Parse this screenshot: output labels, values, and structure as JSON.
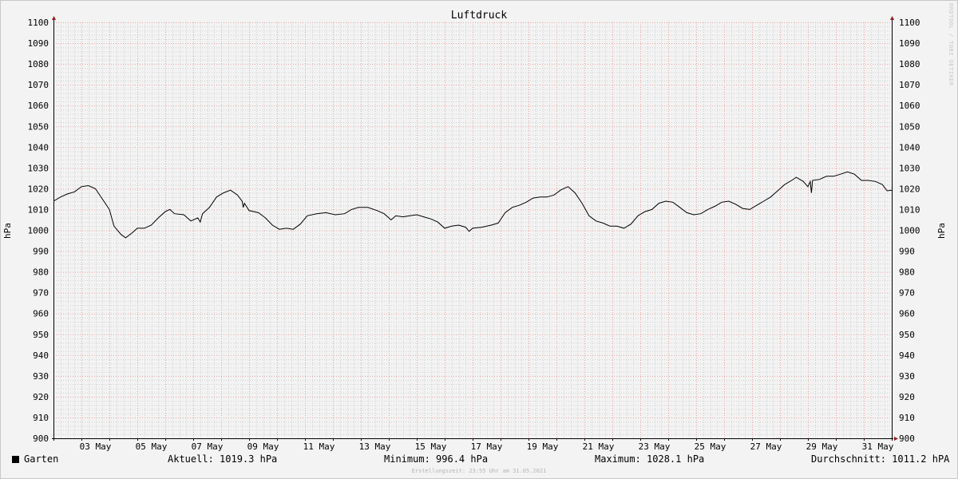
{
  "chart_data": {
    "type": "line",
    "title": "Luftdruck",
    "ylabel_left": "hPa",
    "ylabel_right": "hPa",
    "ylim": [
      900,
      1100
    ],
    "y_ticks": [
      900,
      910,
      920,
      930,
      940,
      950,
      960,
      970,
      980,
      990,
      1000,
      1010,
      1020,
      1030,
      1040,
      1050,
      1060,
      1070,
      1080,
      1090,
      1100
    ],
    "xlim": [
      "2021-05-02 00:00",
      "2021-06-01 00:00"
    ],
    "x_ticks": [
      "03 May",
      "05 May",
      "07 May",
      "09 May",
      "11 May",
      "13 May",
      "15 May",
      "17 May",
      "19 May",
      "21 May",
      "23 May",
      "25 May",
      "27 May",
      "29 May",
      "31 May"
    ],
    "grid": true,
    "series": [
      {
        "name": "Garten",
        "color": "#000000",
        "points": [
          [
            "2021-05-02 00:00",
            1014.0
          ],
          [
            "2021-05-02 06:00",
            1016.0
          ],
          [
            "2021-05-02 12:00",
            1017.5
          ],
          [
            "2021-05-02 18:00",
            1018.5
          ],
          [
            "2021-05-03 00:00",
            1021.0
          ],
          [
            "2021-05-03 06:00",
            1021.5
          ],
          [
            "2021-05-03 12:00",
            1020.0
          ],
          [
            "2021-05-03 18:00",
            1015.0
          ],
          [
            "2021-05-04 00:00",
            1010.0
          ],
          [
            "2021-05-04 04:00",
            1002.0
          ],
          [
            "2021-05-04 10:00",
            998.0
          ],
          [
            "2021-05-04 14:00",
            996.4
          ],
          [
            "2021-05-04 20:00",
            999.0
          ],
          [
            "2021-05-05 00:00",
            1001.0
          ],
          [
            "2021-05-05 06:00",
            1001.0
          ],
          [
            "2021-05-05 12:00",
            1002.5
          ],
          [
            "2021-05-05 18:00",
            1006.0
          ],
          [
            "2021-05-06 00:00",
            1009.0
          ],
          [
            "2021-05-06 04:00",
            1010.0
          ],
          [
            "2021-05-06 08:00",
            1008.0
          ],
          [
            "2021-05-06 16:00",
            1007.5
          ],
          [
            "2021-05-06 22:00",
            1004.5
          ],
          [
            "2021-05-07 04:00",
            1006.0
          ],
          [
            "2021-05-07 06:00",
            1004.0
          ],
          [
            "2021-05-07 08:00",
            1008.0
          ],
          [
            "2021-05-07 14:00",
            1011.0
          ],
          [
            "2021-05-07 20:00",
            1016.0
          ],
          [
            "2021-05-08 02:00",
            1018.0
          ],
          [
            "2021-05-08 08:00",
            1019.3
          ],
          [
            "2021-05-08 14:00",
            1017.0
          ],
          [
            "2021-05-08 18:00",
            1014.0
          ],
          [
            "2021-05-08 19:00",
            1011.0
          ],
          [
            "2021-05-08 20:00",
            1013.0
          ],
          [
            "2021-05-09 00:00",
            1009.5
          ],
          [
            "2021-05-09 08:00",
            1008.5
          ],
          [
            "2021-05-09 14:00",
            1006.0
          ],
          [
            "2021-05-09 20:00",
            1002.5
          ],
          [
            "2021-05-10 02:00",
            1000.5
          ],
          [
            "2021-05-10 08:00",
            1001.0
          ],
          [
            "2021-05-10 14:00",
            1000.5
          ],
          [
            "2021-05-10 20:00",
            1003.0
          ],
          [
            "2021-05-11 02:00",
            1007.0
          ],
          [
            "2021-05-11 10:00",
            1008.0
          ],
          [
            "2021-05-11 18:00",
            1008.5
          ],
          [
            "2021-05-12 02:00",
            1007.5
          ],
          [
            "2021-05-12 10:00",
            1008.0
          ],
          [
            "2021-05-12 16:00",
            1010.0
          ],
          [
            "2021-05-12 22:00",
            1011.0
          ],
          [
            "2021-05-13 06:00",
            1011.0
          ],
          [
            "2021-05-13 14:00",
            1009.5
          ],
          [
            "2021-05-13 20:00",
            1008.0
          ],
          [
            "2021-05-14 02:00",
            1005.0
          ],
          [
            "2021-05-14 06:00",
            1007.0
          ],
          [
            "2021-05-14 12:00",
            1006.5
          ],
          [
            "2021-05-14 18:00",
            1007.0
          ],
          [
            "2021-05-15 00:00",
            1007.5
          ],
          [
            "2021-05-15 06:00",
            1006.5
          ],
          [
            "2021-05-15 12:00",
            1005.5
          ],
          [
            "2021-05-15 18:00",
            1004.0
          ],
          [
            "2021-05-16 00:00",
            1001.0
          ],
          [
            "2021-05-16 06:00",
            1002.0
          ],
          [
            "2021-05-16 12:00",
            1002.5
          ],
          [
            "2021-05-16 18:00",
            1001.5
          ],
          [
            "2021-05-16 21:00",
            999.5
          ],
          [
            "2021-05-17 00:00",
            1001.0
          ],
          [
            "2021-05-17 08:00",
            1001.5
          ],
          [
            "2021-05-17 16:00",
            1002.5
          ],
          [
            "2021-05-17 22:00",
            1003.5
          ],
          [
            "2021-05-18 04:00",
            1008.5
          ],
          [
            "2021-05-18 10:00",
            1011.0
          ],
          [
            "2021-05-18 16:00",
            1012.0
          ],
          [
            "2021-05-18 22:00",
            1013.5
          ],
          [
            "2021-05-19 04:00",
            1015.5
          ],
          [
            "2021-05-19 10:00",
            1016.0
          ],
          [
            "2021-05-19 16:00",
            1016.0
          ],
          [
            "2021-05-19 22:00",
            1017.0
          ],
          [
            "2021-05-20 04:00",
            1019.5
          ],
          [
            "2021-05-20 10:00",
            1021.0
          ],
          [
            "2021-05-20 16:00",
            1018.0
          ],
          [
            "2021-05-20 22:00",
            1013.0
          ],
          [
            "2021-05-21 04:00",
            1007.0
          ],
          [
            "2021-05-21 10:00",
            1004.5
          ],
          [
            "2021-05-21 16:00",
            1003.5
          ],
          [
            "2021-05-21 22:00",
            1002.0
          ],
          [
            "2021-05-22 04:00",
            1002.0
          ],
          [
            "2021-05-22 10:00",
            1001.0
          ],
          [
            "2021-05-22 16:00",
            1003.0
          ],
          [
            "2021-05-22 22:00",
            1007.0
          ],
          [
            "2021-05-23 04:00",
            1009.0
          ],
          [
            "2021-05-23 10:00",
            1010.0
          ],
          [
            "2021-05-23 16:00",
            1013.0
          ],
          [
            "2021-05-23 22:00",
            1014.0
          ],
          [
            "2021-05-24 04:00",
            1013.5
          ],
          [
            "2021-05-24 10:00",
            1011.0
          ],
          [
            "2021-05-24 16:00",
            1008.5
          ],
          [
            "2021-05-24 22:00",
            1007.5
          ],
          [
            "2021-05-25 04:00",
            1008.0
          ],
          [
            "2021-05-25 10:00",
            1010.0
          ],
          [
            "2021-05-25 16:00",
            1011.5
          ],
          [
            "2021-05-25 22:00",
            1013.5
          ],
          [
            "2021-05-26 04:00",
            1014.0
          ],
          [
            "2021-05-26 10:00",
            1012.5
          ],
          [
            "2021-05-26 16:00",
            1010.5
          ],
          [
            "2021-05-26 22:00",
            1010.0
          ],
          [
            "2021-05-27 04:00",
            1012.0
          ],
          [
            "2021-05-27 10:00",
            1014.0
          ],
          [
            "2021-05-27 16:00",
            1016.0
          ],
          [
            "2021-05-27 22:00",
            1019.0
          ],
          [
            "2021-05-28 04:00",
            1022.0
          ],
          [
            "2021-05-28 10:00",
            1024.0
          ],
          [
            "2021-05-28 14:00",
            1025.5
          ],
          [
            "2021-05-28 20:00",
            1023.5
          ],
          [
            "2021-05-29 00:00",
            1021.0
          ],
          [
            "2021-05-29 02:00",
            1023.5
          ],
          [
            "2021-05-29 03:00",
            1018.0
          ],
          [
            "2021-05-29 04:00",
            1024.0
          ],
          [
            "2021-05-29 10:00",
            1024.5
          ],
          [
            "2021-05-29 16:00",
            1026.0
          ],
          [
            "2021-05-29 22:00",
            1026.0
          ],
          [
            "2021-05-30 04:00",
            1027.0
          ],
          [
            "2021-05-30 10:00",
            1028.1
          ],
          [
            "2021-05-30 16:00",
            1027.0
          ],
          [
            "2021-05-30 22:00",
            1024.0
          ],
          [
            "2021-05-31 04:00",
            1024.0
          ],
          [
            "2021-05-31 10:00",
            1023.5
          ],
          [
            "2021-05-31 16:00",
            1022.0
          ],
          [
            "2021-05-31 20:00",
            1019.0
          ],
          [
            "2021-06-01 00:00",
            1019.3
          ]
        ]
      }
    ]
  },
  "legend": {
    "series_name": "Garten",
    "current": "Aktuell: 1019.3 hPa",
    "minimum": "Minimum: 996.4 hPa",
    "maximum": "Maximum: 1028.1 hPa",
    "average": "Durchschnitt: 1011.2 hPA"
  },
  "credit": "RRDTOOL / TOBI OETIKER",
  "footer": "Erstellungszeit: 23:55 Uhr am 31.05.2021",
  "colors": {
    "major_grid": "#e8a3a3",
    "minor_grid": "#d0d0d0",
    "axis": "#000000",
    "arrow": "#9a1a1a",
    "background": "#f3f3f3"
  }
}
